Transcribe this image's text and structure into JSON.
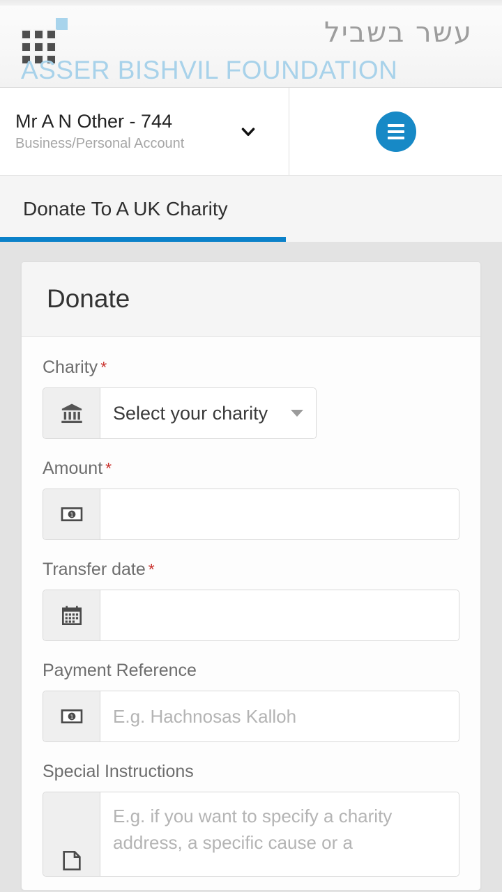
{
  "brand": {
    "hebrew_name": "עשר בשביל",
    "wordmark": "ASSER BISHVIL FOUNDATION",
    "logo_icon": "grid-squares-logo-icon",
    "accent_color": "#a8d2ea",
    "logo_cell_color": "#4f4f4f"
  },
  "account": {
    "name": "Mr A N Other - 744",
    "subtitle": "Business/Personal Account",
    "chevron_icon": "chevron-down-icon",
    "menu_icon": "hamburger-menu-icon",
    "menu_button_color": "#1789c6"
  },
  "tabs": [
    {
      "label": "Donate To A UK Charity",
      "active": true,
      "underline_color": "#0b81c9"
    }
  ],
  "card": {
    "title": "Donate",
    "required_marker": "*",
    "required_color": "#c9302c"
  },
  "form": {
    "fields": [
      {
        "label": "Charity",
        "required": true,
        "type": "select",
        "icon": "bank-institution-icon",
        "value": "Select your charity",
        "caret_icon": "caret-down-icon"
      },
      {
        "label": "Amount",
        "required": true,
        "type": "text",
        "icon": "banknote-icon",
        "value": "",
        "placeholder": ""
      },
      {
        "label": "Transfer date",
        "required": true,
        "type": "text",
        "icon": "calendar-icon",
        "value": "",
        "placeholder": ""
      },
      {
        "label": "Payment Reference",
        "required": false,
        "type": "text",
        "icon": "banknote-icon",
        "value": "",
        "placeholder": "E.g. Hachnosas Kalloh"
      },
      {
        "label": "Special Instructions",
        "required": false,
        "type": "textarea",
        "icon": "note-document-icon",
        "value": "",
        "placeholder": "E.g. if you want to specify a charity address, a specific cause or a"
      }
    ]
  }
}
